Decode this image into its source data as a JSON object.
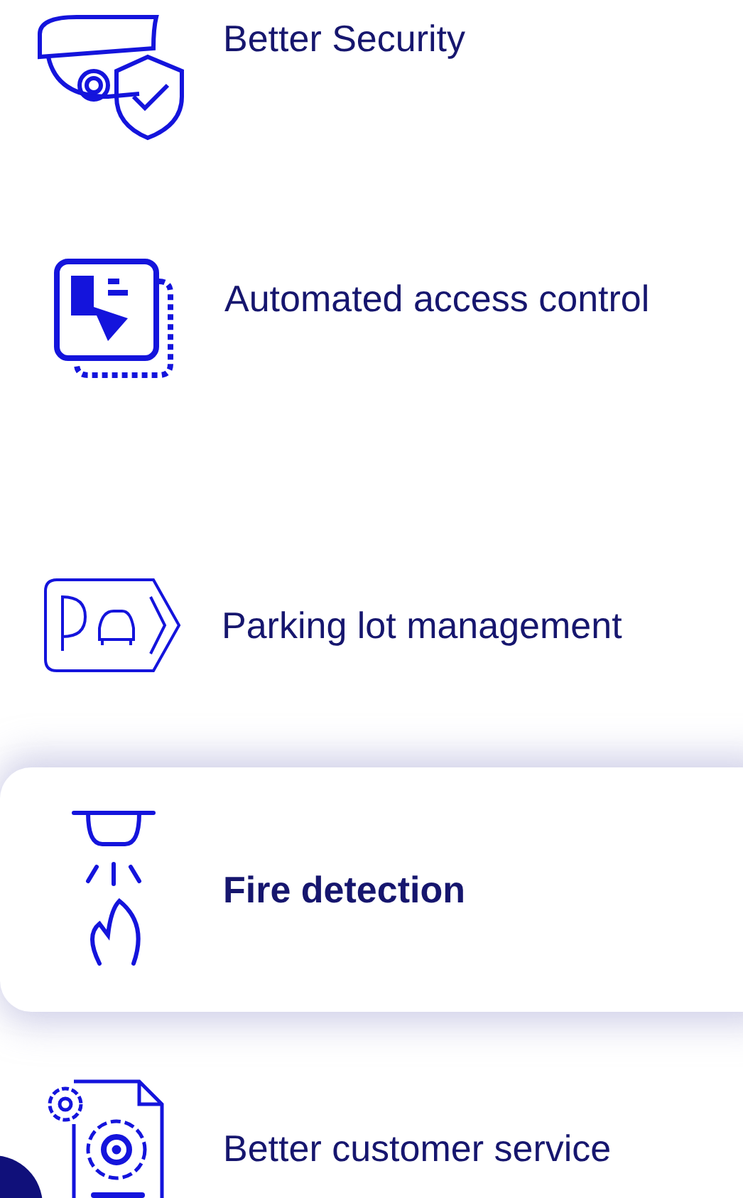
{
  "features": [
    {
      "kind": "camera",
      "label": "Better Security",
      "selected": false
    },
    {
      "kind": "card",
      "label": "Automated access control",
      "selected": false
    },
    {
      "kind": "parking",
      "label": "Parking lot management",
      "selected": false
    },
    {
      "kind": "fire",
      "label": "Fire detection",
      "selected": true
    },
    {
      "kind": "document",
      "label": "Better customer service",
      "selected": false
    }
  ]
}
